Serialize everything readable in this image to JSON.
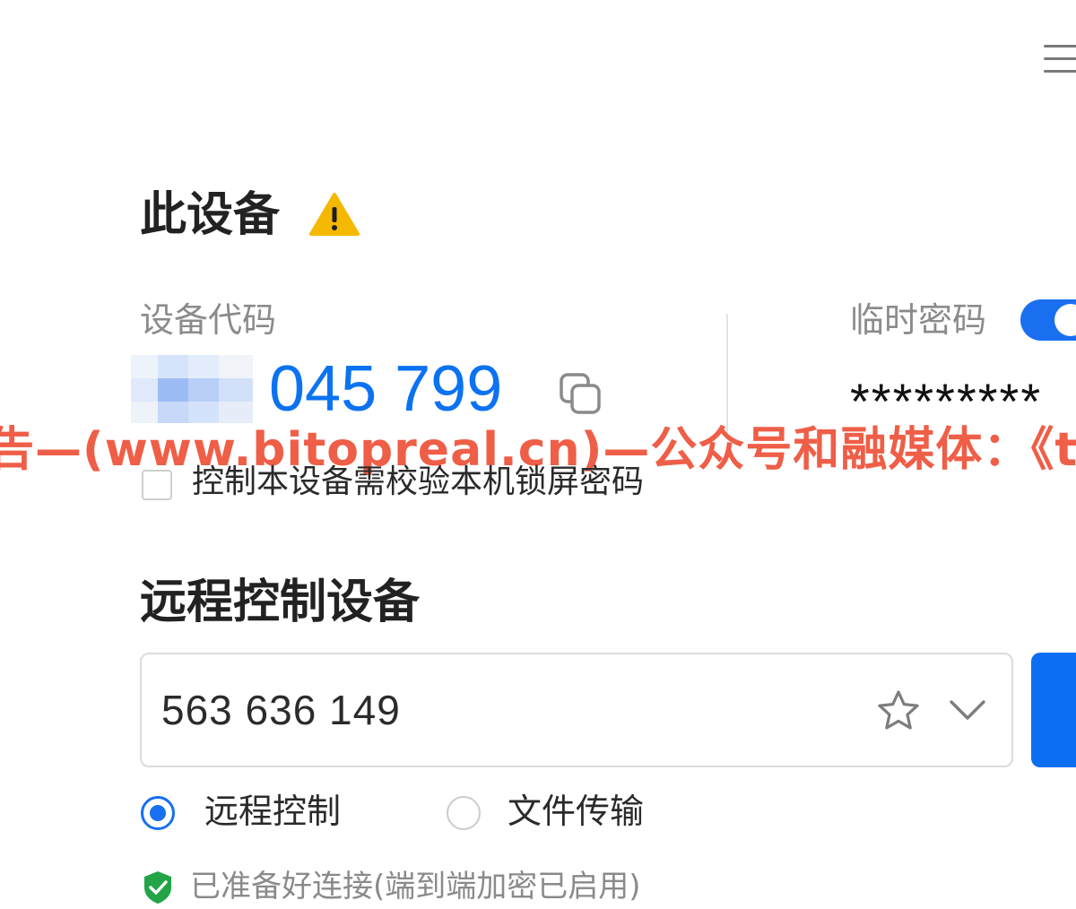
{
  "this_device": {
    "title": "此设备",
    "device_code_label": "设备代码",
    "device_code_visible": "045 799",
    "temp_password_label": "临时密码",
    "temp_password": "*********",
    "lock_check_label": "控制本设备需校验本机锁屏密码",
    "temp_password_enabled": true
  },
  "watermark": "告—(www.bitopreal.cn)—公众号和融媒体：《t",
  "remote": {
    "title": "远程控制设备",
    "device_id_value": "563 636 149",
    "modes": [
      {
        "label": "远程控制",
        "selected": true
      },
      {
        "label": "文件传输",
        "selected": false
      }
    ],
    "status": "已准备好连接(端到端加密已启用)"
  },
  "icons": {
    "menu": "hamburger-menu-icon",
    "warning": "warning-icon",
    "copy": "copy-icon",
    "star": "star-icon",
    "chevron": "chevron-down-icon",
    "shield": "shield-check-icon"
  },
  "colors": {
    "accent": "#0b73f2",
    "warning": "#f5b800",
    "watermark": "#ef5e47",
    "success": "#22a447"
  }
}
